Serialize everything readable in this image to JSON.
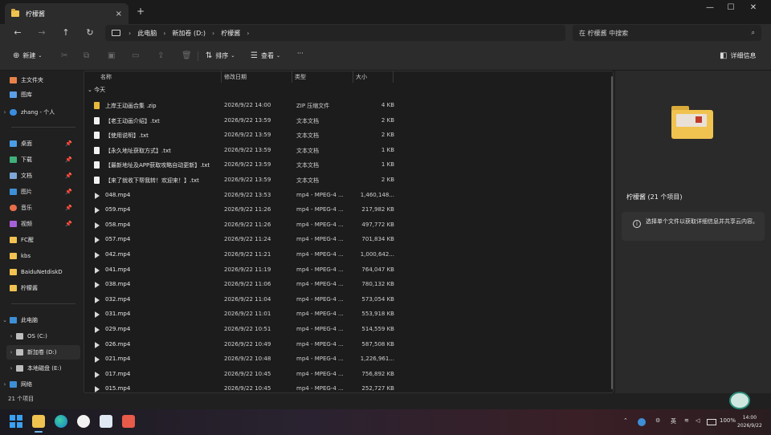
{
  "window": {
    "tab_title": "柠檬酱",
    "new_tab": "+",
    "close_tab": "×",
    "controls": [
      "—",
      "☐",
      "✕"
    ]
  },
  "address": {
    "breadcrumbs": [
      "此电脑",
      "新加卷 (D:)",
      "柠檬酱"
    ],
    "search_placeholder": "在 柠檬酱 中搜索"
  },
  "toolbar": {
    "new_label": "新建",
    "sort_label": "排序",
    "view_label": "查看",
    "more_label": "···",
    "details_label": "详细信息"
  },
  "sidebar": {
    "items": [
      {
        "label": "主文件夹",
        "color": "#e8824a"
      },
      {
        "label": "图库",
        "color": "#5aa0e8"
      },
      {
        "label": "zhang - 个人",
        "color": "#3b8de0"
      },
      {
        "label": "桌面",
        "color": "#4a9ee6"
      },
      {
        "label": "下载",
        "color": "#3fb07a"
      },
      {
        "label": "文档",
        "color": "#7ea6d8"
      },
      {
        "label": "图片",
        "color": "#3d8fd6"
      },
      {
        "label": "音乐",
        "color": "#e86d4a"
      },
      {
        "label": "视频",
        "color": "#a660d8"
      },
      {
        "label": "FC醒",
        "color": "#f0c350"
      },
      {
        "label": "kbs",
        "color": "#f0c350"
      },
      {
        "label": "BaiduNetdiskD",
        "color": "#f0c350"
      },
      {
        "label": "柠檬酱",
        "color": "#f0c350"
      },
      {
        "label": "此电脑",
        "color": "#3d8fd6"
      },
      {
        "label": "OS (C:)",
        "color": "#bdbdbd"
      },
      {
        "label": "新加卷 (D:)",
        "color": "#bdbdbd"
      },
      {
        "label": "本地磁盘 (E:)",
        "color": "#bdbdbd"
      },
      {
        "label": "网络",
        "color": "#3d8fd6"
      }
    ],
    "status": "21 个项目"
  },
  "filelist": {
    "columns": [
      "名称",
      "修改日期",
      "类型",
      "大小"
    ],
    "group": "今天",
    "rows": [
      {
        "name": "上岸王动画合集 .zip",
        "date": "2026/9/22 14:00",
        "type": "ZIP 压缩文件",
        "size": "4 KB",
        "kind": "zip"
      },
      {
        "name": "【老王动画介绍】.txt",
        "date": "2026/9/22 13:59",
        "type": "文本文档",
        "size": "2 KB",
        "kind": "txt"
      },
      {
        "name": "【使用说明】.txt",
        "date": "2026/9/22 13:59",
        "type": "文本文档",
        "size": "2 KB",
        "kind": "txt"
      },
      {
        "name": "【永久地址获取方式】.txt",
        "date": "2026/9/22 13:59",
        "type": "文本文档",
        "size": "1 KB",
        "kind": "txt"
      },
      {
        "name": "【最新地址及APP获取攻略自动更新】.txt",
        "date": "2026/9/22 13:59",
        "type": "文本文档",
        "size": "1 KB",
        "kind": "txt"
      },
      {
        "name": "【来了就收下帮我转！欢迎来！】.txt",
        "date": "2026/9/22 13:59",
        "type": "文本文档",
        "size": "2 KB",
        "kind": "txt"
      },
      {
        "name": "048.mp4",
        "date": "2026/9/22 13:53",
        "type": "mp4 - MPEG-4 ...",
        "size": "1,460,148...",
        "kind": "mp4"
      },
      {
        "name": "059.mp4",
        "date": "2026/9/22 11:26",
        "type": "mp4 - MPEG-4 ...",
        "size": "217,982 KB",
        "kind": "mp4"
      },
      {
        "name": "058.mp4",
        "date": "2026/9/22 11:26",
        "type": "mp4 - MPEG-4 ...",
        "size": "497,772 KB",
        "kind": "mp4"
      },
      {
        "name": "057.mp4",
        "date": "2026/9/22 11:24",
        "type": "mp4 - MPEG-4 ...",
        "size": "701,834 KB",
        "kind": "mp4"
      },
      {
        "name": "042.mp4",
        "date": "2026/9/22 11:21",
        "type": "mp4 - MPEG-4 ...",
        "size": "1,000,642...",
        "kind": "mp4"
      },
      {
        "name": "041.mp4",
        "date": "2026/9/22 11:19",
        "type": "mp4 - MPEG-4 ...",
        "size": "764,047 KB",
        "kind": "mp4"
      },
      {
        "name": "038.mp4",
        "date": "2026/9/22 11:06",
        "type": "mp4 - MPEG-4 ...",
        "size": "780,132 KB",
        "kind": "mp4"
      },
      {
        "name": "032.mp4",
        "date": "2026/9/22 11:04",
        "type": "mp4 - MPEG-4 ...",
        "size": "573,054 KB",
        "kind": "mp4"
      },
      {
        "name": "031.mp4",
        "date": "2026/9/22 11:01",
        "type": "mp4 - MPEG-4 ...",
        "size": "553,918 KB",
        "kind": "mp4"
      },
      {
        "name": "029.mp4",
        "date": "2026/9/22 10:51",
        "type": "mp4 - MPEG-4 ...",
        "size": "514,559 KB",
        "kind": "mp4"
      },
      {
        "name": "026.mp4",
        "date": "2026/9/22 10:49",
        "type": "mp4 - MPEG-4 ...",
        "size": "587,508 KB",
        "kind": "mp4"
      },
      {
        "name": "021.mp4",
        "date": "2026/9/22 10:48",
        "type": "mp4 - MPEG-4 ...",
        "size": "1,226,961...",
        "kind": "mp4"
      },
      {
        "name": "017.mp4",
        "date": "2026/9/22 10:45",
        "type": "mp4 - MPEG-4 ...",
        "size": "756,892 KB",
        "kind": "mp4"
      },
      {
        "name": "015.mp4",
        "date": "2026/9/22 10:45",
        "type": "mp4 - MPEG-4 ...",
        "size": "252,727 KB",
        "kind": "mp4"
      }
    ]
  },
  "details": {
    "title": "柠檬酱 (21 个项目)",
    "info": "选择单个文件以获取详细信息并共享云内容。"
  },
  "taskbar": {
    "tray_ime": "英",
    "battery": "100%",
    "time": "14:00",
    "date": "2026/9/22"
  }
}
